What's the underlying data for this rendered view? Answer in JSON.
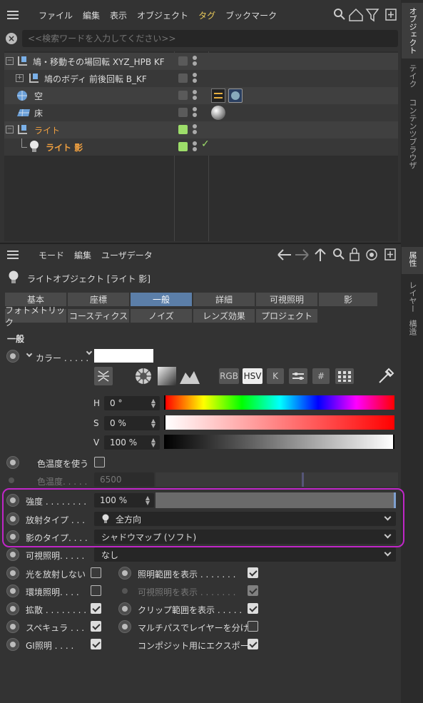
{
  "vtabs_top": [
    "オブジェクト",
    "テイク",
    "コンテンツブラウザ"
  ],
  "vtabs_bottom": [
    "属性",
    "レイヤー",
    "構造"
  ],
  "obj_menu": [
    "ファイル",
    "編集",
    "表示",
    "オブジェクト",
    "タグ",
    "ブックマーク"
  ],
  "search": {
    "placeholder": "<<検索ワードを入力してください>>"
  },
  "tree": [
    {
      "label": "鳩・移動その場回転 XYZ_HPB KF"
    },
    {
      "label": "鳩のボディ 前後回転 B_KF"
    },
    {
      "label": "空"
    },
    {
      "label": "床"
    },
    {
      "label": "ライト"
    },
    {
      "label": "ライト 影"
    }
  ],
  "attr_menu": [
    "モード",
    "編集",
    "ユーザデータ"
  ],
  "object_title": "ライトオブジェクト [ライト 影]",
  "tabs_row1": [
    "基本",
    "座標",
    "一般",
    "詳細",
    "可視照明",
    "影"
  ],
  "tabs_row2": [
    "フォトメトリック",
    "コースティクス",
    "ノイズ",
    "レンズ効果",
    "プロジェクト"
  ],
  "section": "一般",
  "color_label": "カラー . . . . .",
  "color_modes": [
    "RGB",
    "HSV",
    "K"
  ],
  "hsv": [
    {
      "label": "H",
      "value": "0 °"
    },
    {
      "label": "S",
      "value": "0 %"
    },
    {
      "label": "V",
      "value": "100 %"
    }
  ],
  "use_temp_label": "色温度を使う",
  "temp_label": "色温度. . . . .",
  "temp_value": "6500",
  "intensity": {
    "label": "強度 . . . . . . . .",
    "value": "100 %",
    "fraction": 1.0
  },
  "emit_type": {
    "label": "放射タイプ . . .",
    "value": "全方向"
  },
  "shadow_type": {
    "label": "影のタイプ. . . .",
    "value": "シャドウマップ (ソフト)"
  },
  "visible_light": {
    "label": "可視照明. . . . .",
    "value": "なし"
  },
  "checks_left": [
    {
      "label": "光を放射しない",
      "checked": false
    },
    {
      "label": "環境照明. . . .",
      "checked": false
    },
    {
      "label": "拡散 . . . . . . . .",
      "checked": true
    },
    {
      "label": "スペキュラ . . .",
      "checked": true
    },
    {
      "label": "GI照明 . . . .",
      "checked": true
    }
  ],
  "checks_right": [
    {
      "label": "照明範囲を表示 . . . . . . .",
      "checked": true
    },
    {
      "label": "可視照明を表示 . . . . . . .",
      "checked": true
    },
    {
      "label": "クリップ範囲を表示 . . . . .",
      "checked": true
    },
    {
      "label": "マルチパスでレイヤーを分ける",
      "checked": false
    },
    {
      "label": "コンポジット用にエクスポート",
      "checked": true
    }
  ],
  "colors": {
    "accent_tab": "#5b7ea8",
    "highlight_border": "#c026c8",
    "light_green": "#9ddd6a",
    "orange": "#f0a040"
  }
}
